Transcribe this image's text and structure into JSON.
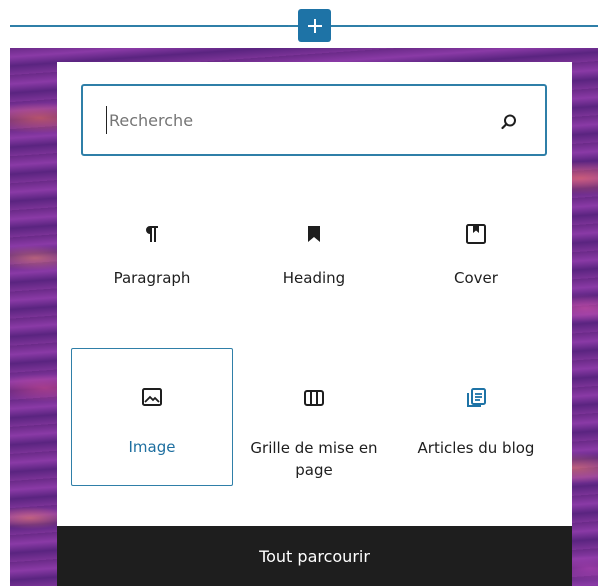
{
  "inserter": {
    "icon": "plus-icon",
    "color": "#1e73a6"
  },
  "search": {
    "placeholder": "Recherche",
    "value": "",
    "icon": "search-icon"
  },
  "blocks": [
    {
      "label": "Paragraph",
      "icon": "paragraph-icon",
      "selected": false
    },
    {
      "label": "Heading",
      "icon": "bookmark-icon",
      "selected": false
    },
    {
      "label": "Cover",
      "icon": "cover-icon",
      "selected": false
    },
    {
      "label": "Image",
      "icon": "image-icon",
      "selected": true
    },
    {
      "label": "Grille de mise en page",
      "icon": "columns-icon",
      "selected": false
    },
    {
      "label": "Articles du blog",
      "icon": "post-list-icon",
      "selected": false
    }
  ],
  "footer": {
    "browse_all_label": "Tout parcourir"
  },
  "colors": {
    "accent": "#2f7fa8",
    "selected_text": "#1e6fa0",
    "footer_bg": "#1e1e1e"
  }
}
